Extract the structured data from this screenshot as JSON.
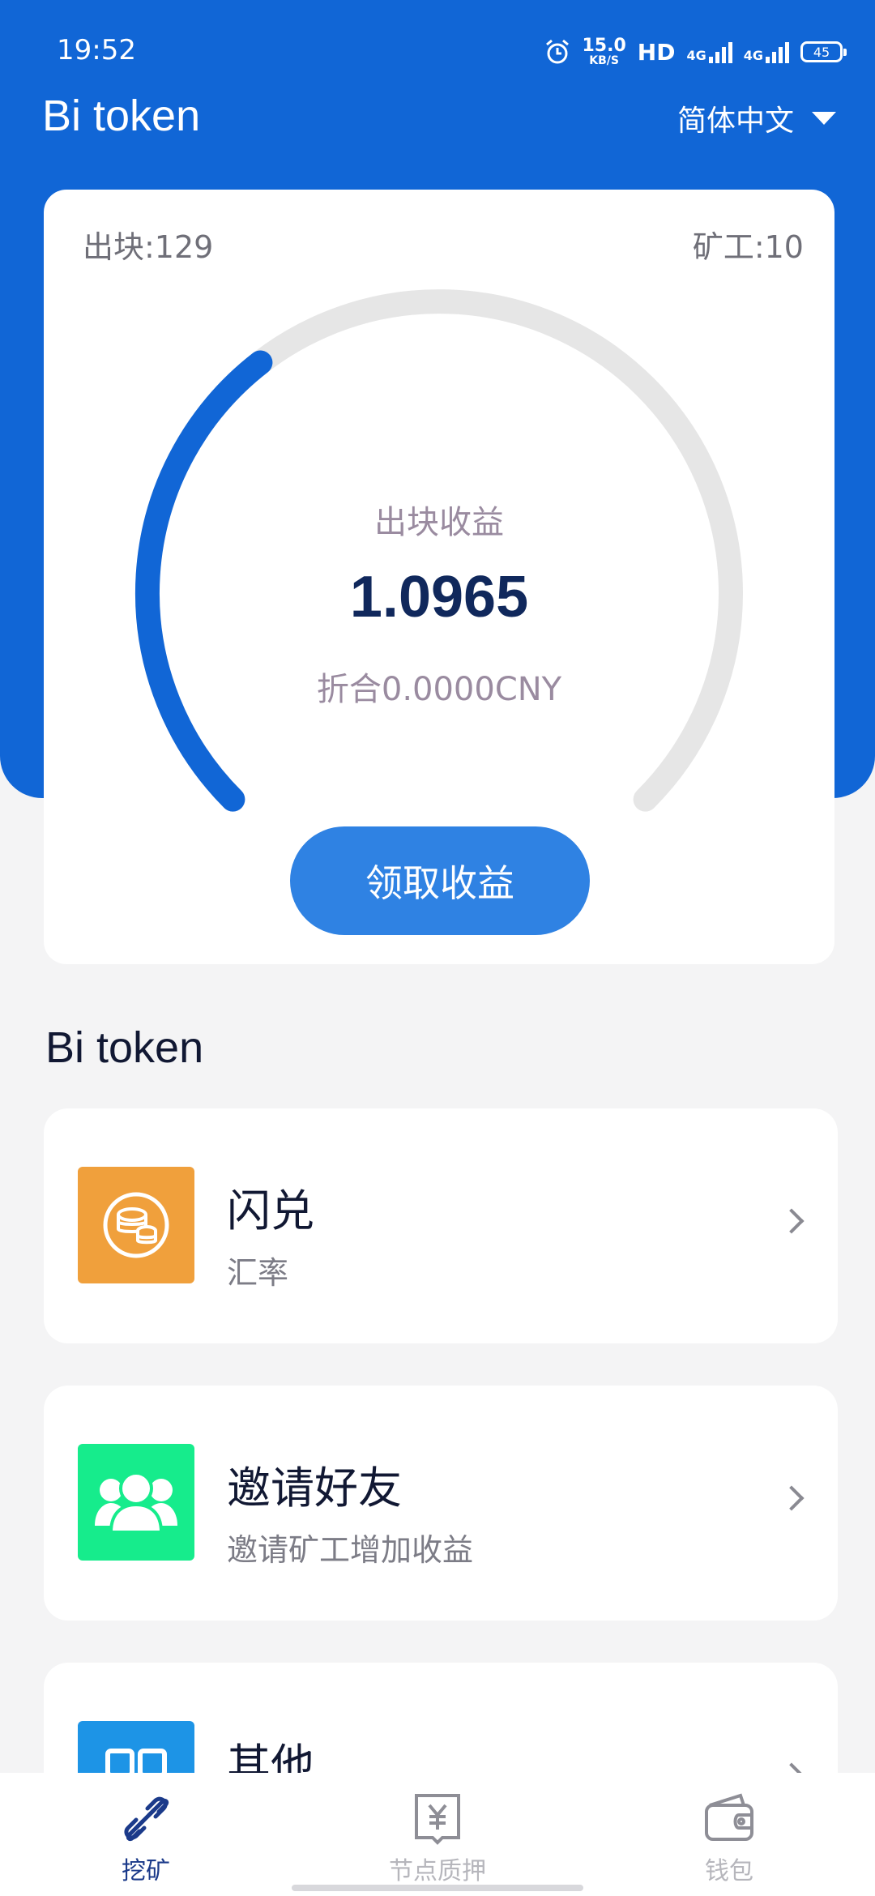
{
  "status_bar": {
    "time": "19:52",
    "net_speed": "15.0",
    "net_unit": "KB/S",
    "hd": "HD",
    "signal1": "4G",
    "signal2": "4G",
    "battery": "45"
  },
  "header": {
    "app_title": "Bi token",
    "language": "简体中文"
  },
  "mining": {
    "blocks_label": "出块:129",
    "miners_label": "矿工:10",
    "progress_fraction": 0.36,
    "earnings_label": "出块收益",
    "earnings_value": "1.0965",
    "cny_label": "折合0.0000CNY",
    "claim_button": "领取收益"
  },
  "section_title": "Bi token",
  "menu": [
    {
      "title": "闪兑",
      "subtitle": "汇率",
      "icon": "coins-icon",
      "color": "#f0a03c"
    },
    {
      "title": "邀请好友",
      "subtitle": "邀请矿工增加收益",
      "icon": "users-icon",
      "color": "#16ec8c"
    },
    {
      "title": "其他",
      "subtitle": "",
      "icon": "grid-icon",
      "color": "#1d94e6"
    }
  ],
  "tabs": [
    {
      "label": "挖矿",
      "icon": "link-icon",
      "active": true
    },
    {
      "label": "节点质押",
      "icon": "yuan-book-icon",
      "active": false
    },
    {
      "label": "钱包",
      "icon": "wallet-icon",
      "active": false
    }
  ],
  "colors": {
    "brand": "#1166d6",
    "gauge_track": "#e6e6e6",
    "tab_active": "#1b3a8a",
    "tab_inactive": "#b6b6bc"
  }
}
